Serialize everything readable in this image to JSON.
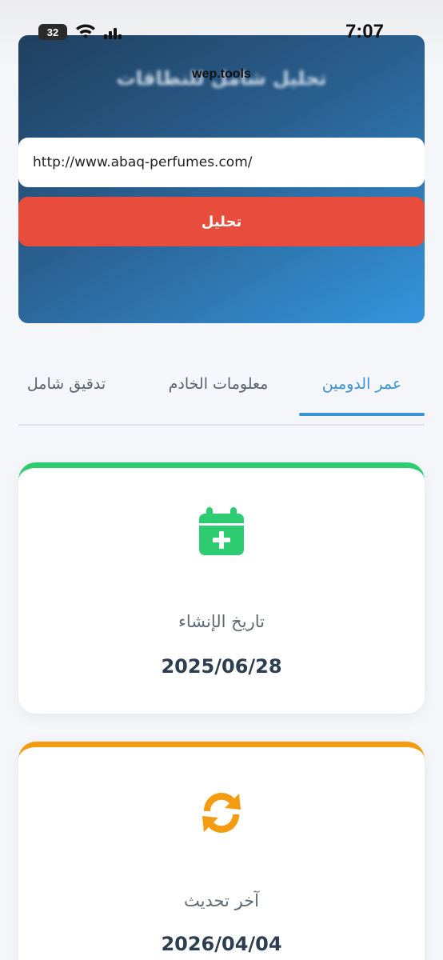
{
  "status_bar": {
    "battery": "32",
    "time": "7:07",
    "icons": [
      "battery-icon",
      "wifi-icon",
      "signal-icon"
    ]
  },
  "hero": {
    "title": "تحليل شامل للنطاقات",
    "watermark": "wep.tools",
    "url_value": "http://www.abaq-perfumes.com/",
    "analyze_label": "تحليل"
  },
  "tabs": [
    {
      "label": "عمر الدومين",
      "active": true
    },
    {
      "label": "معلومات الخادم",
      "active": false
    },
    {
      "label": "تدقيق شامل",
      "active": false
    }
  ],
  "cards": [
    {
      "label": "تاريخ الإنشاء",
      "value": "2025/06/28",
      "icon": "calendar-plus-icon",
      "color": "#2ecc71"
    },
    {
      "label": "آخر تحديث",
      "value": "2026/04/04",
      "icon": "sync-icon",
      "color": "#f39c12"
    }
  ],
  "colors": {
    "accent": "#3a93d2",
    "button": "#e74c3c",
    "hero_start": "#1f3f5f",
    "hero_end": "#3495dc"
  }
}
